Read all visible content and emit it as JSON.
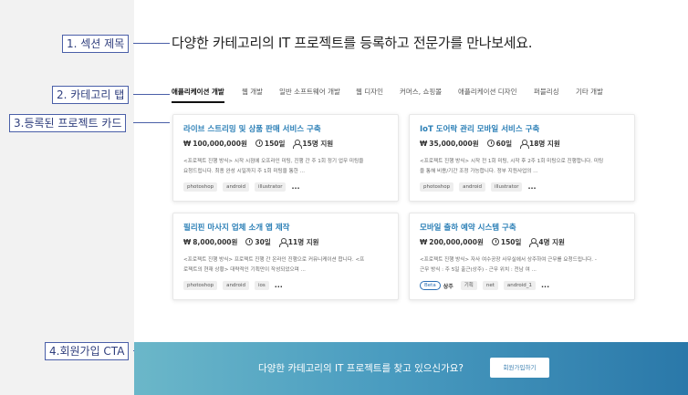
{
  "annotations": {
    "a1": "1. 섹션 제목",
    "a2": "2. 카테고리 탭",
    "a3": "3.등록된 프로젝트 카드",
    "a4": "4.회원가입 CTA"
  },
  "section_title": "다양한 카테고리의 IT 프로젝트를 등록하고 전문가를 만나보세요.",
  "tabs": [
    "애플리케이션 개발",
    "웹 개발",
    "일반 소프트웨어 개발",
    "웹 디자인",
    "커머스, 쇼핑몰",
    "애플리케이션 디자인",
    "퍼블리싱",
    "기타 개발"
  ],
  "cards": [
    {
      "title": "라이브 스트리밍 및 상품 판매 서비스 구축",
      "budget": "100,000,000원",
      "duration": "150일",
      "applicants": "15명 지원",
      "desc": [
        "<프로젝트 진행 방식> 시작 시점에 오프라인 미팅, 진행 간 주 1회 정기 업무 미팅을",
        "요청드립니다. 최종 완성 시일까지 주 1회 미팅을 통한 ..."
      ],
      "tags": [
        "photoshop",
        "android",
        "illustrator"
      ],
      "more": "..."
    },
    {
      "title": "IoT 도어락 관리 모바일 서비스 구축",
      "budget": "35,000,000원",
      "duration": "60일",
      "applicants": "18명 지원",
      "desc": [
        "<프로젝트 진행 방식> 시작 전 1회 미팅, 시작 후 2주 1회 미팅으로 진행합니다. 미팅",
        "을 통해 비용/기간 조정 가능합니다. 정부 지원사업의 ..."
      ],
      "tags": [
        "photoshop",
        "android",
        "illustrator"
      ],
      "more": "..."
    },
    {
      "title": "필리핀 마사지 업체 소개 앱 제작",
      "budget": "8,000,000원",
      "duration": "30일",
      "applicants": "11명 지원",
      "desc": [
        "<프로젝트 진행 방식> 프로젝트 진행 간 온라인 진행으로 커뮤니케이션 합니다. <프",
        "로젝트의 현재 상황> 대략적인 기획만이 작성되었으며 ..."
      ],
      "tags": [
        "photoshop",
        "android",
        "ios"
      ],
      "more": "..."
    },
    {
      "title": "모바일 출하 예약 시스템 구축",
      "budget": "200,000,000원",
      "duration": "150일",
      "applicants": "4명 지원",
      "desc": [
        "<프로젝트 진행 방식> 자사 여수공장 사무실에서 상주하여 근무를 요청드립니다. -",
        "근무 방식 : 주 5일 출근(상주) - 근무 위치 : 전남 여 ..."
      ],
      "beta": "Beta",
      "beta_label": "상주",
      "tags": [
        "기획",
        "net",
        "android_1"
      ],
      "more": "..."
    }
  ],
  "currency_symbol": "₩",
  "cta": {
    "text": "다양한 카테고리의 IT 프로젝트를 찾고 있으신가요?",
    "button": "회원가입하기"
  }
}
